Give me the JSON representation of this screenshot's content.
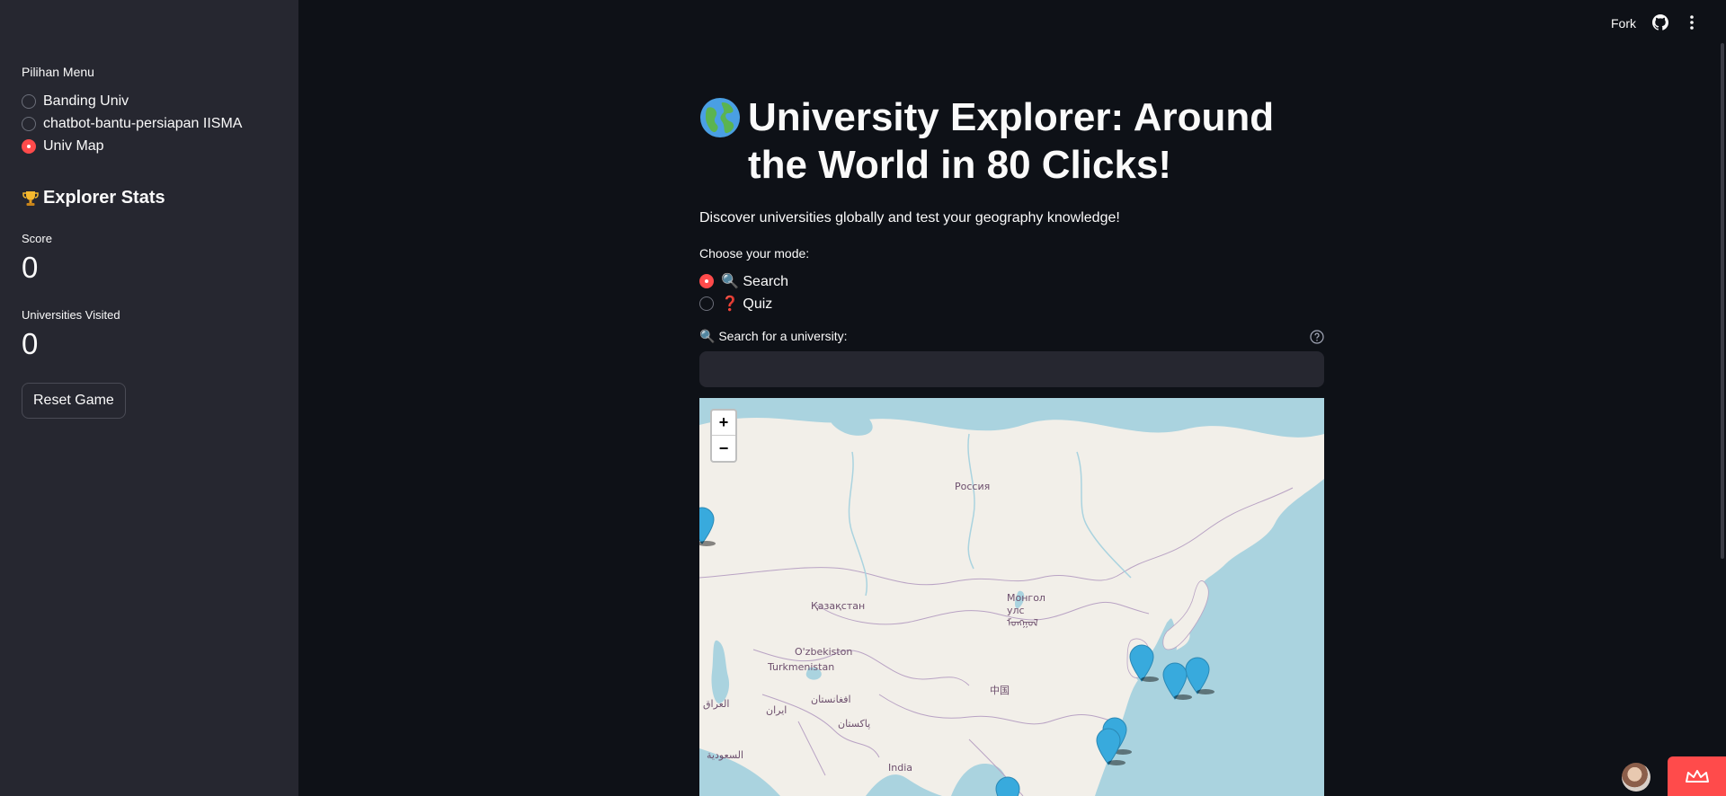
{
  "sidebar": {
    "menu_label": "Pilihan Menu",
    "menu_options": [
      {
        "label": "Banding Univ",
        "selected": false
      },
      {
        "label": "chatbot-bantu-persiapan IISMA",
        "selected": false
      },
      {
        "label": "Univ Map",
        "selected": true
      }
    ],
    "stats_title": "Explorer Stats",
    "stats_icon": "trophy-icon",
    "score_label": "Score",
    "score_value": "0",
    "visited_label": "Universities Visited",
    "visited_value": "0",
    "reset_label": "Reset Game"
  },
  "header": {
    "fork_label": "Fork",
    "github_icon": "github-icon",
    "menu_icon": "kebab-menu-icon"
  },
  "main": {
    "title_icon": "globe-icon",
    "title": "University Explorer: Around the World in 80 Clicks!",
    "subtitle": "Discover universities globally and test your geography knowledge!",
    "mode_label": "Choose your mode:",
    "modes": [
      {
        "label": "🔍 Search",
        "selected": true
      },
      {
        "label": "❓ Quiz",
        "selected": false
      }
    ],
    "search_label": "🔍 Search for a university:",
    "search_value": "",
    "search_placeholder": ""
  },
  "map": {
    "zoom_in": "+",
    "zoom_out": "−",
    "labels": [
      "Россия",
      "Қазақстан",
      "Монгол улс ᠮᠣᠩᠭᠣᠯ",
      "O'zbekiston",
      "Turkmenistan",
      "中国",
      "العراق",
      "ایران",
      "افغانستان",
      "پاکستان",
      "India",
      "السعودية"
    ],
    "marker_color": "#38aadd",
    "marker_count": 7
  },
  "colors": {
    "accent": "#ff4b4b",
    "background": "#0e1117",
    "sidebar": "#262730"
  }
}
